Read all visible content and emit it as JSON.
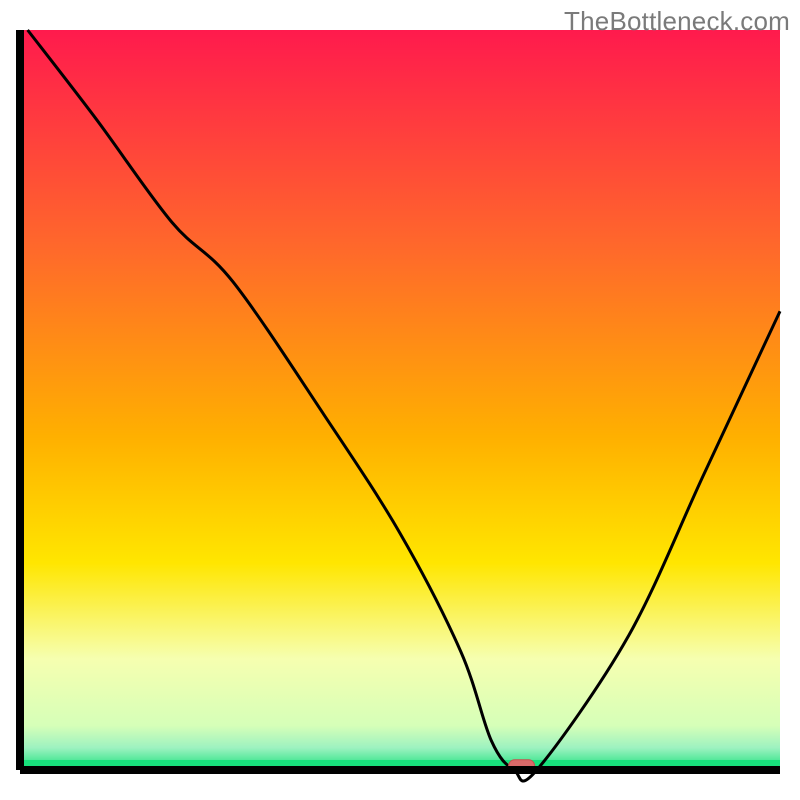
{
  "watermark": "TheBottleneck.com",
  "chart_data": {
    "type": "line",
    "title": "",
    "xlabel": "",
    "ylabel": "",
    "xlim": [
      0,
      100
    ],
    "ylim": [
      0,
      100
    ],
    "grid": false,
    "legend": false,
    "series": [
      {
        "name": "bottleneck-curve",
        "x": [
          1,
          10,
          20,
          28,
          40,
          50,
          58,
          62,
          65,
          68,
          80,
          90,
          100
        ],
        "values": [
          100,
          88,
          74,
          66,
          48,
          32,
          16,
          4,
          0,
          0,
          18,
          40,
          62
        ]
      }
    ],
    "marker": {
      "name": "optimal-point",
      "x": 66,
      "y": 0.5,
      "color": "#d96a6a"
    },
    "background_gradient": {
      "top": "#ff1a4d",
      "upper_mid": "#ffb000",
      "mid": "#ffe600",
      "lower": "#f6ffb0",
      "bottom_band_light": "#9df2c0",
      "bottom_band": "#18e07c"
    },
    "colors": {
      "axis": "#000000",
      "curve": "#000000",
      "marker_fill": "#d96a6a",
      "marker_stroke": "#c94f4f"
    }
  }
}
